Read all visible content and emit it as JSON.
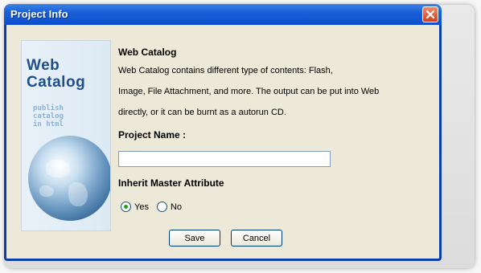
{
  "window": {
    "title": "Project Info",
    "titlebar_color": "#0d4fcb"
  },
  "side_image": {
    "brand_line1": "Web",
    "brand_line2": "Catalog",
    "tagline_line1": "publish",
    "tagline_line2": "catalog",
    "tagline_line3": "in html"
  },
  "content": {
    "heading": "Web Catalog",
    "description_line1": "Web Catalog contains different type of contents: Flash,",
    "description_line2": "Image, File Attachment, and more. The output can be put into Web",
    "description_line3": "directly, or it can be burnt as a autorun CD.",
    "project_name_label": "Project Name :",
    "project_name_value": "",
    "inherit_label": "Inherit Master Attribute",
    "radio_yes_label": "Yes",
    "radio_no_label": "No",
    "radio_selected": "Yes"
  },
  "buttons": {
    "save": "Save",
    "cancel": "Cancel"
  },
  "icons": {
    "close": "close-icon"
  }
}
